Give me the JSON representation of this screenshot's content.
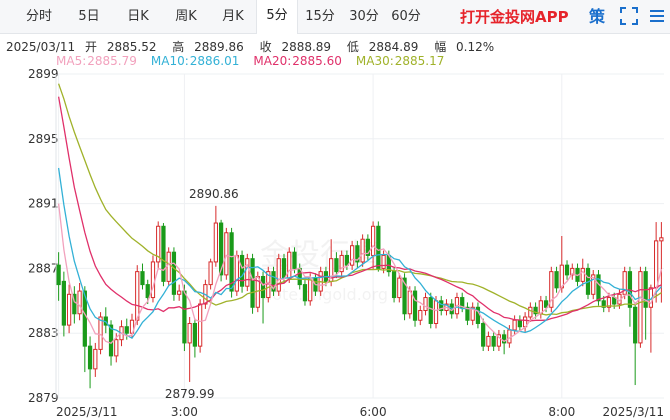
{
  "tabs": [
    {
      "label": "分时",
      "name": "tab-timeshare"
    },
    {
      "label": "5日",
      "name": "tab-5day"
    },
    {
      "label": "日K",
      "name": "tab-daily-k"
    },
    {
      "label": "周K",
      "name": "tab-weekly-k"
    },
    {
      "label": "月K",
      "name": "tab-monthly-k"
    },
    {
      "label": "5分",
      "name": "tab-5min"
    },
    {
      "label": "15分",
      "name": "tab-15min"
    },
    {
      "label": "30分",
      "name": "tab-30min"
    },
    {
      "label": "60分",
      "name": "tab-60min"
    }
  ],
  "active_tab": 5,
  "app_link": "打开金投网APP",
  "strategy_label": "策",
  "quote": {
    "date": "2025/03/11",
    "open_label": "开",
    "open": "2885.52",
    "high_label": "高",
    "high": "2889.86",
    "close_label": "收",
    "close": "2888.89",
    "low_label": "低",
    "low": "2884.89",
    "amp_label": "幅",
    "amp": "0.12%"
  },
  "colors": {
    "up": "#d72b2b",
    "down": "#1a9a1a",
    "ma5": "#f2a1bd",
    "ma10": "#33b1d6",
    "ma20": "#e0306a",
    "ma30": "#a0b22a",
    "grid": "#eef0f3",
    "axis_text": "#333333",
    "active_tab_text": "#222222",
    "app_link": "#e6242b"
  },
  "chart_data": {
    "type": "candlestick",
    "title": "",
    "xlabel": "",
    "ylabel": "",
    "ylim": [
      2879,
      2899
    ],
    "y_ticks": [
      "2899",
      "2895",
      "2891",
      "2887",
      "2883",
      "2879"
    ],
    "x_ticks": [
      {
        "index": 0,
        "label": "2025/3/11"
      },
      {
        "index": 24,
        "label": "3:00"
      },
      {
        "index": 60,
        "label": "6:00"
      },
      {
        "index": 96,
        "label": "8:00"
      },
      {
        "index": 117,
        "label": "2025/3/11"
      }
    ],
    "grid": true,
    "annotations": [
      {
        "index": 30,
        "value": 2890.86,
        "label": "2890.86"
      },
      {
        "index": 25,
        "value": 2879.99,
        "label": "2879.99"
      }
    ],
    "legend": [
      {
        "key": "ma5",
        "label": "MA5:",
        "value": "2885.79"
      },
      {
        "key": "ma10",
        "label": "MA10:",
        "value": "2886.01"
      },
      {
        "key": "ma20",
        "label": "MA20:",
        "value": "2885.60"
      },
      {
        "key": "ma30",
        "label": "MA30:",
        "value": "2885.17"
      }
    ],
    "candles": [
      [
        2887.2,
        2886.0,
        2888.0,
        2885.0
      ],
      [
        2886.2,
        2883.5,
        2886.8,
        2882.8
      ],
      [
        2883.5,
        2885.4,
        2886.0,
        2883.0
      ],
      [
        2885.4,
        2884.2,
        2885.9,
        2883.6
      ],
      [
        2884.2,
        2885.6,
        2886.1,
        2883.8
      ],
      [
        2885.6,
        2882.2,
        2885.9,
        2880.6
      ],
      [
        2882.2,
        2880.8,
        2882.8,
        2879.6
      ],
      [
        2880.8,
        2882.0,
        2882.4,
        2880.3
      ],
      [
        2882.0,
        2884.0,
        2884.3,
        2881.7
      ],
      [
        2884.0,
        2883.5,
        2884.6,
        2883.0
      ],
      [
        2883.5,
        2881.6,
        2883.8,
        2881.0
      ],
      [
        2881.6,
        2882.6,
        2883.0,
        2881.2
      ],
      [
        2882.6,
        2883.4,
        2883.8,
        2882.2
      ],
      [
        2883.4,
        2883.0,
        2883.9,
        2882.6
      ],
      [
        2883.0,
        2883.8,
        2884.2,
        2882.7
      ],
      [
        2883.8,
        2886.8,
        2887.2,
        2883.5
      ],
      [
        2886.8,
        2886.0,
        2887.3,
        2885.7
      ],
      [
        2886.0,
        2885.2,
        2886.3,
        2884.8
      ],
      [
        2885.2,
        2887.4,
        2887.8,
        2884.9
      ],
      [
        2887.4,
        2889.6,
        2889.9,
        2887.0
      ],
      [
        2889.6,
        2886.2,
        2889.8,
        2885.9
      ],
      [
        2886.2,
        2888.0,
        2888.3,
        2885.9
      ],
      [
        2888.0,
        2885.4,
        2888.3,
        2885.0
      ],
      [
        2885.4,
        2885.6,
        2886.0,
        2885.0
      ],
      [
        2885.6,
        2882.4,
        2886.0,
        2881.9
      ],
      [
        2882.4,
        2883.6,
        2884.0,
        2879.99
      ],
      [
        2883.6,
        2882.2,
        2883.9,
        2881.5
      ],
      [
        2882.2,
        2884.8,
        2885.1,
        2881.8
      ],
      [
        2884.8,
        2886.0,
        2886.3,
        2884.5
      ],
      [
        2886.0,
        2887.4,
        2887.6,
        2885.7
      ],
      [
        2887.4,
        2889.8,
        2890.86,
        2887.1
      ],
      [
        2889.8,
        2886.6,
        2890.0,
        2886.2
      ],
      [
        2886.6,
        2889.2,
        2889.5,
        2886.3
      ],
      [
        2889.2,
        2885.6,
        2889.5,
        2885.2
      ],
      [
        2885.6,
        2887.8,
        2888.1,
        2885.3
      ],
      [
        2887.8,
        2885.9,
        2888.1,
        2885.5
      ],
      [
        2885.9,
        2887.6,
        2887.9,
        2885.6
      ],
      [
        2887.6,
        2884.6,
        2887.9,
        2884.2
      ],
      [
        2884.6,
        2886.5,
        2886.8,
        2884.3
      ],
      [
        2886.5,
        2885.2,
        2886.8,
        2883.6
      ],
      [
        2885.2,
        2886.8,
        2887.1,
        2884.9
      ],
      [
        2886.8,
        2885.6,
        2887.1,
        2885.3
      ],
      [
        2885.6,
        2887.6,
        2887.9,
        2885.3
      ],
      [
        2887.6,
        2886.4,
        2887.9,
        2886.1
      ],
      [
        2886.4,
        2888.0,
        2888.3,
        2886.1
      ],
      [
        2888.0,
        2887.0,
        2888.3,
        2886.7
      ],
      [
        2887.0,
        2886.0,
        2887.3,
        2885.7
      ],
      [
        2886.0,
        2885.0,
        2886.3,
        2884.7
      ],
      [
        2885.0,
        2886.4,
        2886.7,
        2884.7
      ],
      [
        2886.4,
        2885.6,
        2886.7,
        2885.3
      ],
      [
        2885.6,
        2886.8,
        2887.1,
        2885.3
      ],
      [
        2886.8,
        2886.2,
        2887.1,
        2885.9
      ],
      [
        2886.2,
        2887.6,
        2888.8,
        2885.9
      ],
      [
        2887.6,
        2886.8,
        2888.0,
        2886.4
      ],
      [
        2886.8,
        2887.8,
        2888.1,
        2886.5
      ],
      [
        2887.8,
        2887.2,
        2888.1,
        2886.9
      ],
      [
        2887.2,
        2888.4,
        2888.7,
        2886.9
      ],
      [
        2888.4,
        2887.4,
        2888.7,
        2887.0
      ],
      [
        2887.4,
        2888.8,
        2889.1,
        2887.1
      ],
      [
        2888.8,
        2887.8,
        2889.1,
        2887.5
      ],
      [
        2887.8,
        2889.6,
        2889.9,
        2886.9
      ],
      [
        2889.6,
        2887.0,
        2889.9,
        2886.8
      ],
      [
        2887.0,
        2887.8,
        2888.1,
        2886.7
      ],
      [
        2887.8,
        2886.8,
        2888.1,
        2886.5
      ],
      [
        2886.8,
        2885.2,
        2887.1,
        2884.9
      ],
      [
        2885.2,
        2886.4,
        2886.7,
        2884.9
      ],
      [
        2886.4,
        2884.2,
        2886.7,
        2883.8
      ],
      [
        2884.2,
        2885.6,
        2885.9,
        2883.9
      ],
      [
        2885.6,
        2883.8,
        2885.9,
        2883.4
      ],
      [
        2883.8,
        2884.4,
        2884.7,
        2883.5
      ],
      [
        2884.4,
        2885.2,
        2885.5,
        2884.1
      ],
      [
        2885.2,
        2883.6,
        2885.5,
        2883.3
      ],
      [
        2883.6,
        2885.0,
        2885.3,
        2883.3
      ],
      [
        2885.0,
        2884.4,
        2885.3,
        2884.1
      ],
      [
        2884.4,
        2884.8,
        2885.1,
        2884.1
      ],
      [
        2884.8,
        2884.2,
        2885.1,
        2883.9
      ],
      [
        2884.2,
        2885.2,
        2885.5,
        2883.9
      ],
      [
        2885.2,
        2884.6,
        2885.5,
        2884.3
      ],
      [
        2884.6,
        2883.8,
        2884.9,
        2883.5
      ],
      [
        2883.8,
        2884.6,
        2884.9,
        2883.5
      ],
      [
        2884.6,
        2883.6,
        2884.9,
        2883.3
      ],
      [
        2883.6,
        2882.2,
        2883.9,
        2881.9
      ],
      [
        2882.2,
        2882.8,
        2883.1,
        2881.9
      ],
      [
        2882.8,
        2882.2,
        2883.1,
        2881.9
      ],
      [
        2882.2,
        2882.9,
        2883.2,
        2881.9
      ],
      [
        2882.9,
        2882.4,
        2883.2,
        2881.7
      ],
      [
        2882.4,
        2883.2,
        2883.5,
        2882.1
      ],
      [
        2883.2,
        2883.8,
        2884.1,
        2882.9
      ],
      [
        2883.8,
        2883.4,
        2884.1,
        2883.1
      ],
      [
        2883.4,
        2884.0,
        2884.3,
        2883.1
      ],
      [
        2884.0,
        2884.6,
        2884.9,
        2883.7
      ],
      [
        2884.6,
        2884.2,
        2884.9,
        2883.9
      ],
      [
        2884.2,
        2885.0,
        2885.3,
        2883.9
      ],
      [
        2885.0,
        2884.6,
        2885.3,
        2884.3
      ],
      [
        2884.6,
        2886.8,
        2887.1,
        2884.3
      ],
      [
        2886.8,
        2885.8,
        2887.1,
        2885.5
      ],
      [
        2885.8,
        2887.2,
        2889.0,
        2885.5
      ],
      [
        2887.2,
        2886.6,
        2887.5,
        2886.3
      ],
      [
        2886.6,
        2887.0,
        2887.3,
        2886.3
      ],
      [
        2887.0,
        2886.2,
        2887.3,
        2885.9
      ],
      [
        2886.2,
        2887.0,
        2887.6,
        2885.9
      ],
      [
        2887.0,
        2885.4,
        2887.3,
        2885.1
      ],
      [
        2885.4,
        2886.6,
        2886.9,
        2885.1
      ],
      [
        2886.6,
        2885.0,
        2886.9,
        2884.7
      ],
      [
        2885.0,
        2884.6,
        2885.3,
        2884.3
      ],
      [
        2884.6,
        2885.2,
        2885.5,
        2884.3
      ],
      [
        2885.2,
        2884.8,
        2885.5,
        2884.5
      ],
      [
        2884.8,
        2885.4,
        2885.7,
        2884.5
      ],
      [
        2885.4,
        2886.8,
        2887.1,
        2885.1
      ],
      [
        2886.8,
        2884.6,
        2887.1,
        2883.4
      ],
      [
        2884.6,
        2882.4,
        2884.9,
        2879.8
      ],
      [
        2882.4,
        2886.8,
        2887.1,
        2882.1
      ],
      [
        2886.8,
        2884.6,
        2887.1,
        2882.6
      ],
      [
        2884.6,
        2885.8,
        2886.0,
        2881.8
      ],
      [
        2885.8,
        2888.7,
        2889.86,
        2884.89
      ],
      [
        2888.7,
        2888.89,
        2889.86,
        2884.89
      ]
    ]
  }
}
